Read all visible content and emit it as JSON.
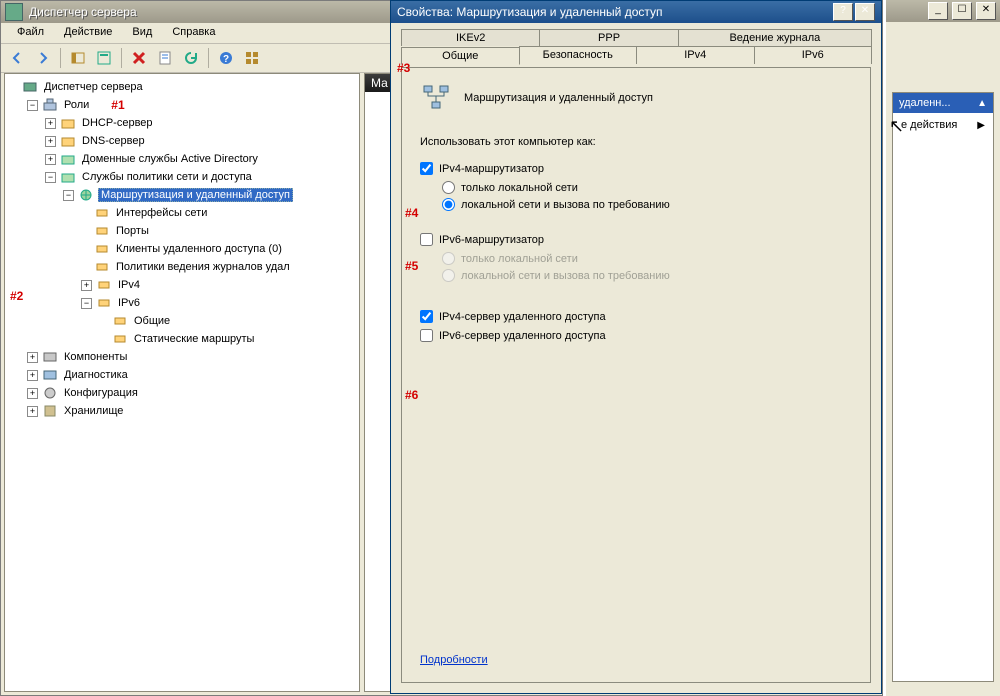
{
  "mainwin": {
    "title": "Диспетчер сервера",
    "menu": [
      "Файл",
      "Действие",
      "Вид",
      "Справка"
    ],
    "header_strip": "Ма"
  },
  "annotations": {
    "a1": "#1",
    "a2": "#2",
    "a3": "#3",
    "a4": "#4",
    "a5": "#5",
    "a6": "#6"
  },
  "tree": {
    "root": "Диспетчер сервера",
    "roles": "Роли",
    "dhcp": "DHCP-сервер",
    "dns": "DNS-сервер",
    "ad": "Доменные службы Active Directory",
    "nps": "Службы политики сети и доступа",
    "rras": "Маршрутизация и удаленный доступ",
    "ifaces": "Интерфейсы сети",
    "ports": "Порты",
    "clients": "Клиенты удаленного доступа (0)",
    "logpol": "Политики ведения журналов удал",
    "ipv4": "IPv4",
    "ipv6": "IPv6",
    "general": "Общие",
    "static": "Статические маршруты",
    "components": "Компоненты",
    "diag": "Диагностика",
    "config": "Конфигурация",
    "storage": "Хранилище"
  },
  "dlg": {
    "title": "Свойства: Маршрутизация и удаленный доступ",
    "tabs_back": [
      "IKEv2",
      "PPP",
      "Ведение журнала"
    ],
    "tabs_front": [
      "Общие",
      "Безопасность",
      "IPv4",
      "IPv6"
    ],
    "header": "Маршрутизация и удаленный доступ",
    "use_as": "Использовать этот компьютер как:",
    "ipv4_router": "IPv4-маршрутизатор",
    "only_lan": "только локальной сети",
    "lan_dial": "локальной сети и вызова по требованию",
    "ipv6_router": "IPv6-маршрутизатор",
    "ipv4_ras": "IPv4-сервер удаленного доступа",
    "ipv6_ras": "IPv6-сервер удаленного доступа",
    "details": "Подробности"
  },
  "rside": {
    "blue": "удаленн...",
    "actions": "е действия"
  }
}
